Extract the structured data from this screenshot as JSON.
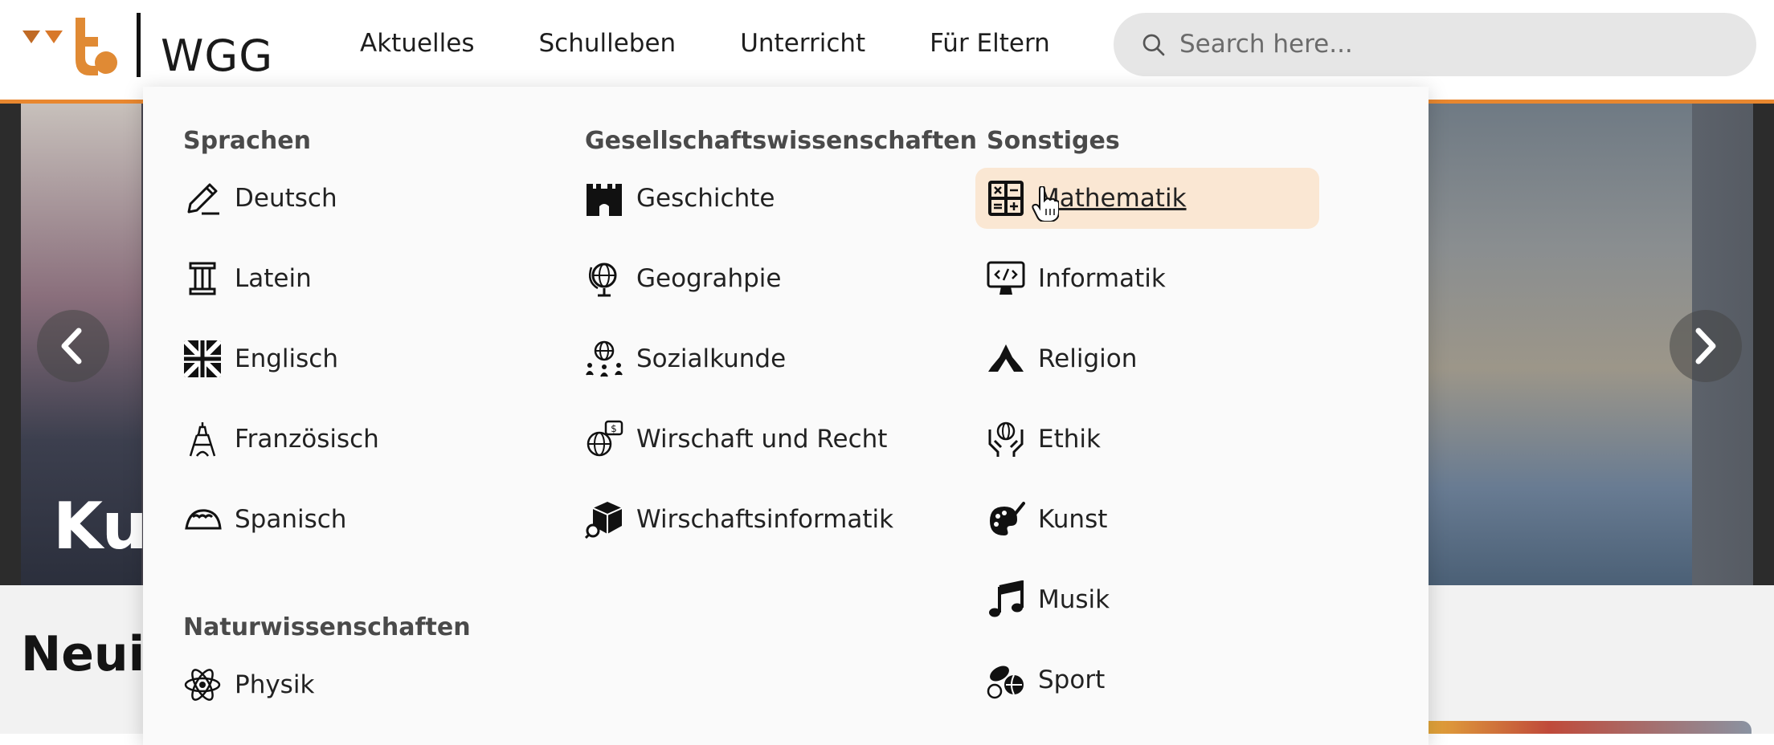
{
  "header": {
    "logo_text": "WGG",
    "nav": [
      "Aktuelles",
      "Schulleben",
      "Unterricht",
      "Für Eltern"
    ],
    "search_placeholder": "Search here...",
    "accent_color": "#e8872f"
  },
  "hero": {
    "title_fragment": "Ku",
    "prev_icon": "chevron-left-icon",
    "next_icon": "chevron-right-icon"
  },
  "section": {
    "title_fragment": "Neuig"
  },
  "dropdown": {
    "columns": [
      {
        "heading": "Sprachen",
        "items": [
          {
            "label": "Deutsch",
            "icon": "pencil-icon"
          },
          {
            "label": "Latein",
            "icon": "column-icon"
          },
          {
            "label": "Englisch",
            "icon": "union-jack-icon"
          },
          {
            "label": "Französisch",
            "icon": "eiffel-tower-icon"
          },
          {
            "label": "Spanisch",
            "icon": "taco-icon"
          }
        ]
      },
      {
        "heading": "Gesellschaftswissenschaften",
        "items": [
          {
            "label": "Geschichte",
            "icon": "castle-icon"
          },
          {
            "label": "Geograhpie",
            "icon": "globe-icon"
          },
          {
            "label": "Sozialkunde",
            "icon": "people-globe-icon"
          },
          {
            "label": "Wirschaft und Recht",
            "icon": "money-globe-icon"
          },
          {
            "label": "Wirschaftsinformatik",
            "icon": "cube-search-icon"
          }
        ]
      },
      {
        "heading": "Sonstiges",
        "items": [
          {
            "label": "Mathematik",
            "icon": "calculator-icon",
            "active": true
          },
          {
            "label": "Informatik",
            "icon": "code-monitor-icon"
          },
          {
            "label": "Religion",
            "icon": "praying-hands-icon"
          },
          {
            "label": "Ethik",
            "icon": "hands-globe-icon"
          },
          {
            "label": "Kunst",
            "icon": "palette-icon"
          },
          {
            "label": "Musik",
            "icon": "music-note-icon"
          },
          {
            "label": "Sport",
            "icon": "balls-icon"
          }
        ]
      }
    ],
    "extra_heading": "Naturwissenschaften",
    "extra_items": [
      {
        "label": "Physik",
        "icon": "atom-icon"
      }
    ]
  }
}
